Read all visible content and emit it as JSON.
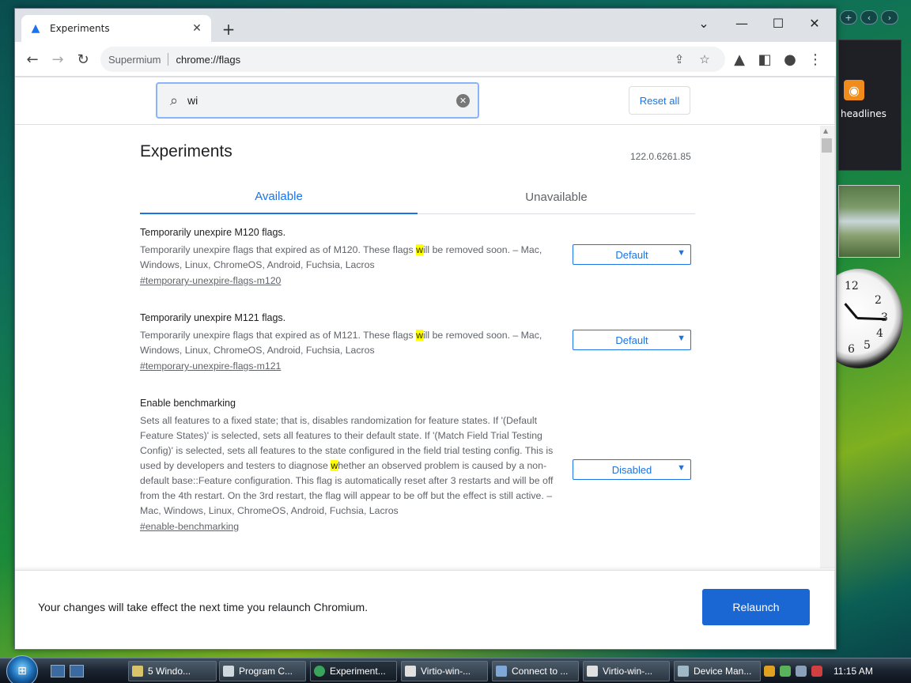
{
  "window": {
    "tab_title": "Experiments",
    "controls": [
      "chevron-down",
      "minimize",
      "maximize",
      "close"
    ]
  },
  "toolbar": {
    "site_name": "Supermium",
    "url": "chrome://flags"
  },
  "search": {
    "value": "wi",
    "reset_label": "Reset all"
  },
  "page": {
    "title": "Experiments",
    "version": "122.0.6261.85",
    "tabs": [
      {
        "label": "Available",
        "active": true
      },
      {
        "label": "Unavailable",
        "active": false
      }
    ]
  },
  "flags": [
    {
      "name": "Temporarily unexpire M120 flags.",
      "desc_before": "Temporarily unexpire flags that expired as of M120. These flags ",
      "desc_hl": "w",
      "desc_after": "ill be removed soon. – Mac, Windows, Linux, ChromeOS, Android, Fuchsia, Lacros",
      "link": "#temporary-unexpire-flags-m120",
      "value": "Default"
    },
    {
      "name": "Temporarily unexpire M121 flags.",
      "desc_before": "Temporarily unexpire flags that expired as of M121. These flags ",
      "desc_hl": "w",
      "desc_after": "ill be removed soon. – Mac, Windows, Linux, ChromeOS, Android, Fuchsia, Lacros",
      "link": "#temporary-unexpire-flags-m121",
      "value": "Default"
    },
    {
      "name": "Enable benchmarking",
      "desc_before": "Sets all features to a fixed state; that is, disables randomization for feature states. If '(Default Feature States)' is selected, sets all features to their default state. If '(Match Field Trial Testing Config)' is selected, sets all features to the state configured in the field trial testing config. This is used by developers and testers to diagnose ",
      "desc_hl": "w",
      "desc_after": "hether an observed problem is caused by a non-default base::Feature configuration. This flag is automatically reset after 3 restarts and will be off from the 4th restart. On the 3rd restart, the flag will appear to be off but the effect is still active. – Mac, Windows, Linux, ChromeOS, Android, Fuchsia, Lacros",
      "link": "#enable-benchmarking",
      "value": "Disabled"
    }
  ],
  "relaunch": {
    "message": "Your changes will take effect the next time you relaunch Chromium.",
    "button": "Relaunch"
  },
  "sidebar": {
    "feed_label": "headlines",
    "clock_numbers": [
      "12",
      "2",
      "3",
      "4",
      "5",
      "6"
    ]
  },
  "taskbar": {
    "buttons": [
      "5 Windo...",
      "Program C...",
      "Experiment...",
      "Virtio-win-...",
      "Connect to ...",
      "Virtio-win-...",
      "Device Man..."
    ],
    "active_index": 2,
    "time": "11:15 AM"
  },
  "colors": {
    "accent": "#1a73e8",
    "highlight": "#ffff00",
    "relaunch_button": "#1a66d2"
  }
}
